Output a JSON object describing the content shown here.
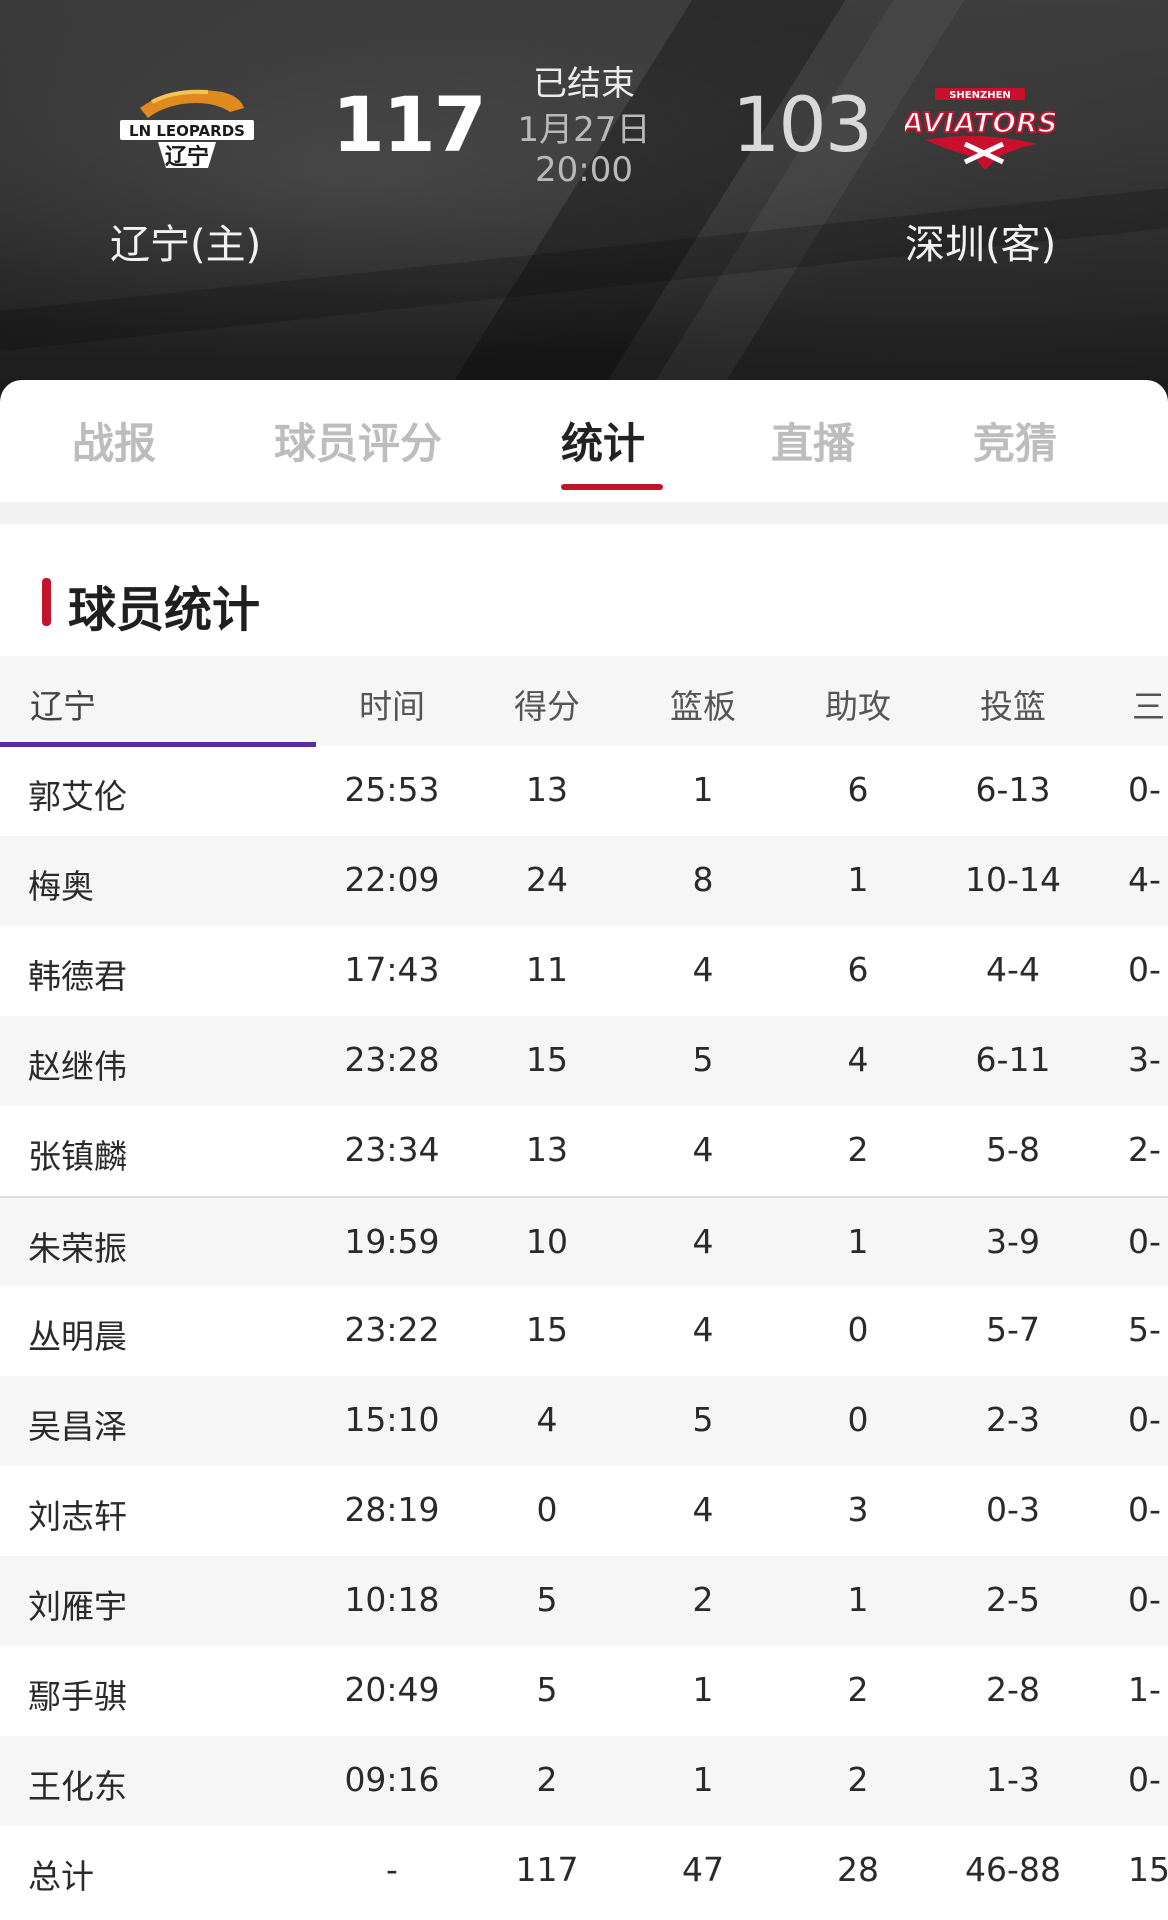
{
  "header": {
    "home": {
      "name": "辽宁(主)",
      "score": "117",
      "logo_text_top": "LN LEOPARDS",
      "logo_text_bottom": "辽宁"
    },
    "away": {
      "name": "深圳(客)",
      "score": "103",
      "logo_text_top": "SHENZHEN",
      "logo_text_bottom": "AVIATORS"
    },
    "status": "已结束",
    "date": "1月27日",
    "time": "20:00"
  },
  "tabs": [
    {
      "label": "战报"
    },
    {
      "label": "球员评分"
    },
    {
      "label": "统计",
      "active": true
    },
    {
      "label": "直播"
    },
    {
      "label": "竞猜"
    }
  ],
  "section": {
    "title": "球员统计",
    "team_tab": "辽宁",
    "columns": [
      "时间",
      "得分",
      "篮板",
      "助攻",
      "投篮",
      "三"
    ],
    "rows": [
      {
        "name": "郭艾伦",
        "time": "25:53",
        "pts": "13",
        "reb": "1",
        "ast": "6",
        "fg": "6-13",
        "tp": "0-"
      },
      {
        "name": "梅奥",
        "time": "22:09",
        "pts": "24",
        "reb": "8",
        "ast": "1",
        "fg": "10-14",
        "tp": "4-"
      },
      {
        "name": "韩德君",
        "time": "17:43",
        "pts": "11",
        "reb": "4",
        "ast": "6",
        "fg": "4-4",
        "tp": "0-"
      },
      {
        "name": "赵继伟",
        "time": "23:28",
        "pts": "15",
        "reb": "5",
        "ast": "4",
        "fg": "6-11",
        "tp": "3-"
      },
      {
        "name": "张镇麟",
        "time": "23:34",
        "pts": "13",
        "reb": "4",
        "ast": "2",
        "fg": "5-8",
        "tp": "2-"
      },
      {
        "name": "朱荣振",
        "time": "19:59",
        "pts": "10",
        "reb": "4",
        "ast": "1",
        "fg": "3-9",
        "tp": "0-"
      },
      {
        "name": "丛明晨",
        "time": "23:22",
        "pts": "15",
        "reb": "4",
        "ast": "0",
        "fg": "5-7",
        "tp": "5-"
      },
      {
        "name": "吴昌泽",
        "time": "15:10",
        "pts": "4",
        "reb": "5",
        "ast": "0",
        "fg": "2-3",
        "tp": "0-"
      },
      {
        "name": "刘志轩",
        "time": "28:19",
        "pts": "0",
        "reb": "4",
        "ast": "3",
        "fg": "0-3",
        "tp": "0-"
      },
      {
        "name": "刘雁宇",
        "time": "10:18",
        "pts": "5",
        "reb": "2",
        "ast": "1",
        "fg": "2-5",
        "tp": "0-"
      },
      {
        "name": "鄢手骐",
        "time": "20:49",
        "pts": "5",
        "reb": "1",
        "ast": "2",
        "fg": "2-8",
        "tp": "1-"
      },
      {
        "name": "王化东",
        "time": "09:16",
        "pts": "2",
        "reb": "1",
        "ast": "2",
        "fg": "1-3",
        "tp": "0-"
      },
      {
        "name": "总计",
        "time": "-",
        "pts": "117",
        "reb": "47",
        "ast": "28",
        "fg": "46-88",
        "tp": "15-"
      }
    ]
  },
  "colors": {
    "accent": "#c3142b",
    "team_tab_underline": "#5b2c9c"
  }
}
